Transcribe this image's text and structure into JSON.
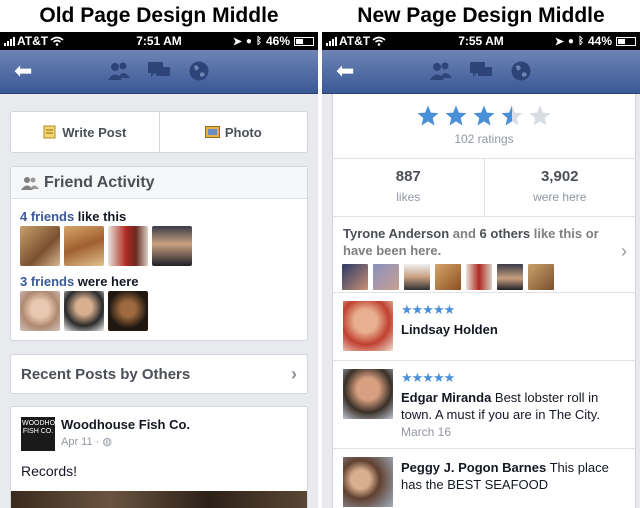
{
  "left": {
    "caption": "Old Page Design Middle",
    "status": {
      "carrier": "AT&T",
      "time": "7:51 AM",
      "battery": "46%",
      "battery_level": 0.46
    },
    "write_post": "Write Post",
    "photo": "Photo",
    "friend_activity": {
      "title": "Friend Activity",
      "like_count": "4 friends",
      "like_text": " like this",
      "been_count": "3 friends",
      "been_text": " were here"
    },
    "recent_posts": "Recent Posts by Others",
    "post": {
      "author": "Woodhouse Fish Co.",
      "logo_text": "WOODHOUSE FISH CO.",
      "date": "Apr 11 ·",
      "text": "Records!"
    }
  },
  "right": {
    "caption": "New Page Design Middle",
    "status": {
      "carrier": "AT&T",
      "time": "7:55 AM",
      "battery": "44%",
      "battery_level": 0.44
    },
    "rating_stars": 3.5,
    "ratings_text": "102 ratings",
    "stats": [
      {
        "num": "887",
        "label": "likes"
      },
      {
        "num": "3,902",
        "label": "were here"
      }
    ],
    "friends": {
      "name": "Tyrone Anderson",
      "mid1": " and ",
      "others": "6 others",
      "mid2": " like this or have been here."
    },
    "reviews": [
      {
        "stars": "★★★★★",
        "name": "Lindsay Holden",
        "body": "",
        "date": ""
      },
      {
        "stars": "★★★★★",
        "name": "Edgar Miranda",
        "body": " Best lobster roll in town. A must if you are in The City.",
        "date": "March 16"
      },
      {
        "stars": "",
        "name": "Peggy J. Pogon Barnes",
        "body": " This place has the BEST SEAFOOD",
        "date": ""
      }
    ]
  },
  "colors": {
    "facebook_blue": "#3b5998",
    "star_blue": "#4a90d9"
  }
}
